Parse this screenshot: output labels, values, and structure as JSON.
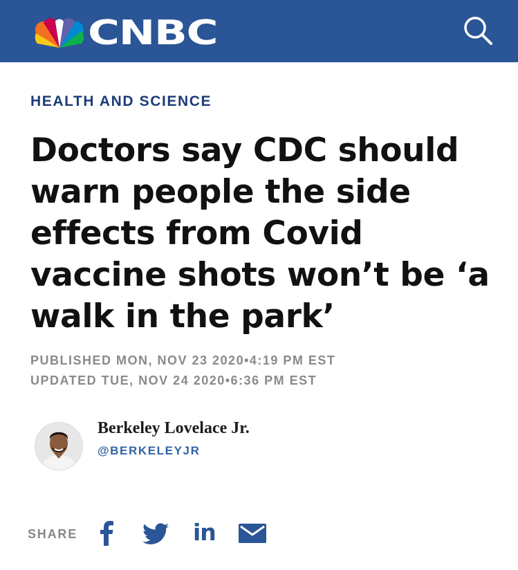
{
  "header": {
    "brand": "CNBC",
    "logo_icon": "nbc-peacock-icon",
    "search_icon": "search-icon",
    "background": "#2a5596"
  },
  "article": {
    "category": "HEALTH AND SCIENCE",
    "headline": "Doctors say CDC should warn people the side effects from Covid vaccine shots won’t be ‘a walk in the park’",
    "published": "PUBLISHED MON, NOV 23 2020•4:19 PM EST",
    "updated": "UPDATED TUE, NOV 24 2020•6:36 PM EST"
  },
  "author": {
    "name": "Berkeley Lovelace Jr.",
    "handle": "@BERKELEYJR",
    "avatar_icon": "author-avatar"
  },
  "share": {
    "label": "SHARE",
    "icons": [
      "facebook-icon",
      "twitter-icon",
      "linkedin-icon",
      "email-icon"
    ],
    "linkedin_text": "in",
    "icon_color": "#2a5596"
  }
}
